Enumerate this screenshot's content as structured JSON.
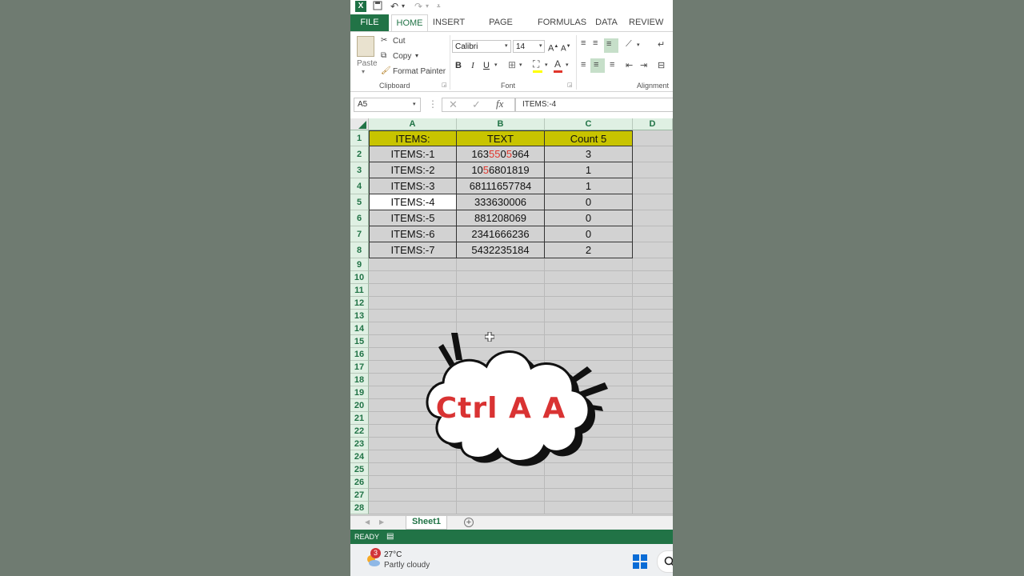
{
  "qat": {
    "icons": [
      "excel-logo",
      "save-icon",
      "undo-icon",
      "redo-icon",
      "customize-icon"
    ]
  },
  "tabs": [
    {
      "label": "FILE"
    },
    {
      "label": "HOME"
    },
    {
      "label": "INSERT"
    },
    {
      "label": "PAGE LAYOUT"
    },
    {
      "label": "FORMULAS"
    },
    {
      "label": "DATA"
    },
    {
      "label": "REVIEW"
    }
  ],
  "ribbon": {
    "clipboard": {
      "paste": "Paste",
      "cut": "Cut",
      "copy": "Copy",
      "format_painter": "Format Painter",
      "label": "Clipboard"
    },
    "font": {
      "name": "Calibri",
      "size": "14",
      "bold": "B",
      "italic": "I",
      "underline": "U",
      "label": "Font"
    },
    "alignment": {
      "label": "Alignment"
    }
  },
  "formula_bar": {
    "name_box": "A5",
    "fx": "fx",
    "value": "ITEMS:-4"
  },
  "grid": {
    "columns": [
      "A",
      "B",
      "C",
      "D"
    ],
    "rows": [
      "1",
      "2",
      "3",
      "4",
      "5",
      "6",
      "7",
      "8",
      "9",
      "10",
      "11",
      "12",
      "13",
      "14",
      "15",
      "16",
      "17",
      "18",
      "19",
      "20",
      "21",
      "22",
      "23",
      "24",
      "25",
      "26",
      "27",
      "28"
    ],
    "header": [
      "ITEMS:",
      "TEXT",
      "Count  5"
    ],
    "data": [
      {
        "a": "ITEMS:-1",
        "b": [
          {
            "t": "163"
          },
          {
            "t": "5",
            "r": true
          },
          {
            "t": "5",
            "r": true
          },
          {
            "t": "0"
          },
          {
            "t": "5",
            "r": true
          },
          {
            "t": "964"
          }
        ],
        "c": "3"
      },
      {
        "a": "ITEMS:-2",
        "b": [
          {
            "t": "10"
          },
          {
            "t": "5",
            "r": true
          },
          {
            "t": "6801819"
          }
        ],
        "c": "1"
      },
      {
        "a": "ITEMS:-3",
        "b": [
          {
            "t": "68111657784"
          }
        ],
        "c": "1"
      },
      {
        "a": "ITEMS:-4",
        "b": [
          {
            "t": "333630006"
          }
        ],
        "c": "0"
      },
      {
        "a": "ITEMS:-5",
        "b": [
          {
            "t": "881208069"
          }
        ],
        "c": "0"
      },
      {
        "a": "ITEMS:-6",
        "b": [
          {
            "t": "2341666236"
          }
        ],
        "c": "0"
      },
      {
        "a": "ITEMS:-7",
        "b": [
          {
            "t": "5432235184"
          }
        ],
        "c": "2"
      }
    ],
    "header_fill": "#c8c400",
    "selected_fill": "#d2d2d2"
  },
  "overlay": {
    "text": "Ctrl A A",
    "color": "#d93333"
  },
  "sheet": {
    "tab": "Sheet1",
    "add": "+"
  },
  "status": {
    "text": "READY"
  },
  "taskbar": {
    "badge": "3",
    "temp": "27°C",
    "weather": "Partly cloudy"
  }
}
